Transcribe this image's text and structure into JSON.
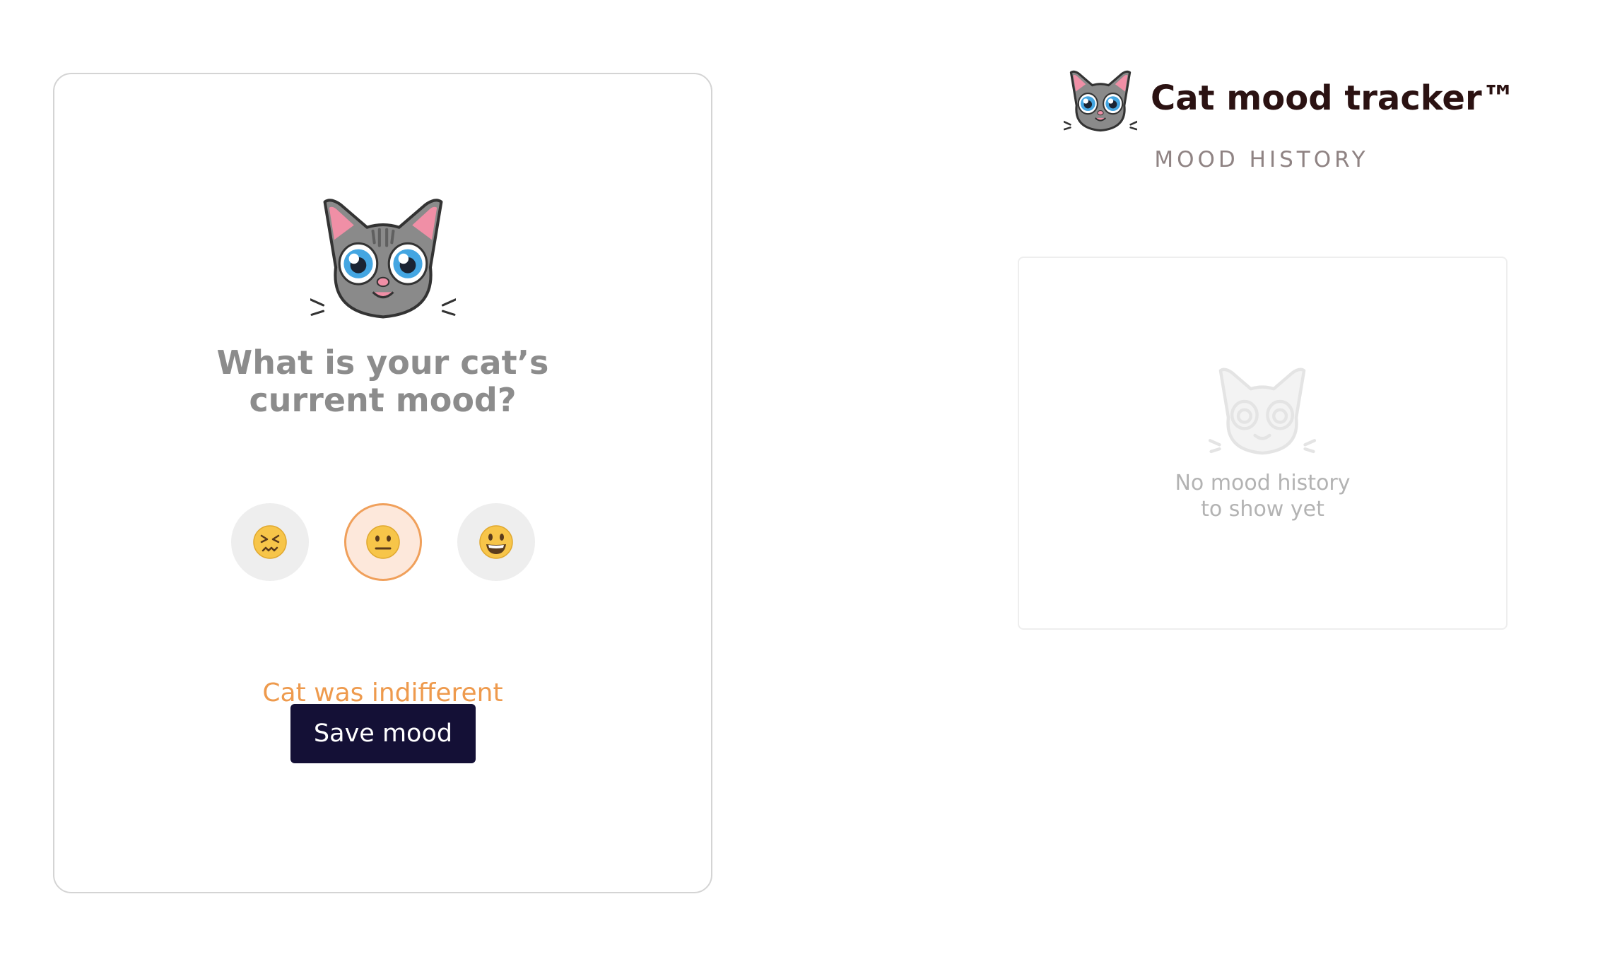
{
  "form": {
    "question_line1": "What is your cat’s",
    "question_line2": "current mood?",
    "moods": [
      {
        "emoji": "😖",
        "icon": "confounded-face-icon",
        "selected": false
      },
      {
        "emoji": "😐",
        "icon": "neutral-face-icon",
        "selected": true
      },
      {
        "emoji": "😃",
        "icon": "grinning-face-icon",
        "selected": false
      }
    ],
    "status": "Cat was indifferent",
    "save_label": "Save mood"
  },
  "header": {
    "title": "Cat mood tracker™",
    "section": "MOOD HISTORY"
  },
  "history": {
    "empty_line1": "No mood history",
    "empty_line2": "to show yet"
  },
  "colors": {
    "accent": "#ee9a4d",
    "button": "#141036",
    "title": "#2b1212"
  }
}
